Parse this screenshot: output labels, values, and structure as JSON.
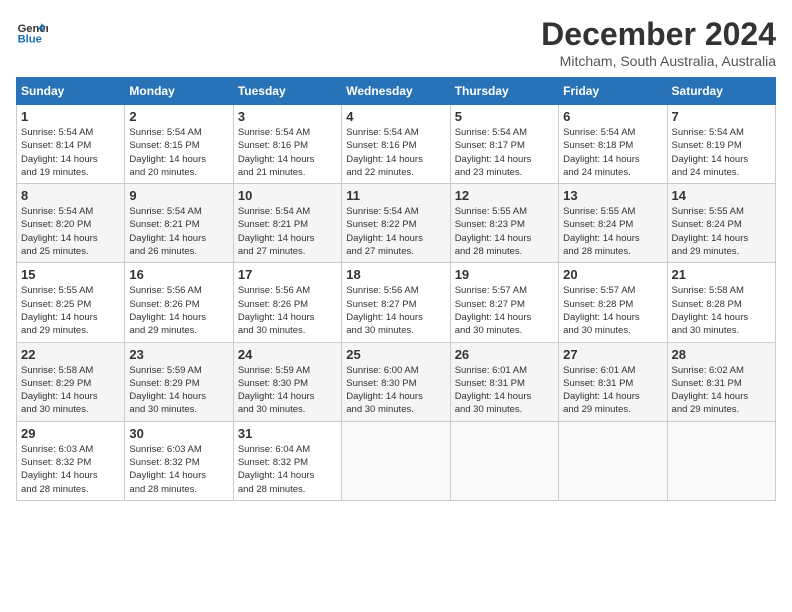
{
  "header": {
    "logo_line1": "General",
    "logo_line2": "Blue",
    "month": "December 2024",
    "location": "Mitcham, South Australia, Australia"
  },
  "days_of_week": [
    "Sunday",
    "Monday",
    "Tuesday",
    "Wednesday",
    "Thursday",
    "Friday",
    "Saturday"
  ],
  "weeks": [
    [
      {
        "day": "1",
        "info": "Sunrise: 5:54 AM\nSunset: 8:14 PM\nDaylight: 14 hours\nand 19 minutes."
      },
      {
        "day": "2",
        "info": "Sunrise: 5:54 AM\nSunset: 8:15 PM\nDaylight: 14 hours\nand 20 minutes."
      },
      {
        "day": "3",
        "info": "Sunrise: 5:54 AM\nSunset: 8:16 PM\nDaylight: 14 hours\nand 21 minutes."
      },
      {
        "day": "4",
        "info": "Sunrise: 5:54 AM\nSunset: 8:16 PM\nDaylight: 14 hours\nand 22 minutes."
      },
      {
        "day": "5",
        "info": "Sunrise: 5:54 AM\nSunset: 8:17 PM\nDaylight: 14 hours\nand 23 minutes."
      },
      {
        "day": "6",
        "info": "Sunrise: 5:54 AM\nSunset: 8:18 PM\nDaylight: 14 hours\nand 24 minutes."
      },
      {
        "day": "7",
        "info": "Sunrise: 5:54 AM\nSunset: 8:19 PM\nDaylight: 14 hours\nand 24 minutes."
      }
    ],
    [
      {
        "day": "8",
        "info": "Sunrise: 5:54 AM\nSunset: 8:20 PM\nDaylight: 14 hours\nand 25 minutes."
      },
      {
        "day": "9",
        "info": "Sunrise: 5:54 AM\nSunset: 8:21 PM\nDaylight: 14 hours\nand 26 minutes."
      },
      {
        "day": "10",
        "info": "Sunrise: 5:54 AM\nSunset: 8:21 PM\nDaylight: 14 hours\nand 27 minutes."
      },
      {
        "day": "11",
        "info": "Sunrise: 5:54 AM\nSunset: 8:22 PM\nDaylight: 14 hours\nand 27 minutes."
      },
      {
        "day": "12",
        "info": "Sunrise: 5:55 AM\nSunset: 8:23 PM\nDaylight: 14 hours\nand 28 minutes."
      },
      {
        "day": "13",
        "info": "Sunrise: 5:55 AM\nSunset: 8:24 PM\nDaylight: 14 hours\nand 28 minutes."
      },
      {
        "day": "14",
        "info": "Sunrise: 5:55 AM\nSunset: 8:24 PM\nDaylight: 14 hours\nand 29 minutes."
      }
    ],
    [
      {
        "day": "15",
        "info": "Sunrise: 5:55 AM\nSunset: 8:25 PM\nDaylight: 14 hours\nand 29 minutes."
      },
      {
        "day": "16",
        "info": "Sunrise: 5:56 AM\nSunset: 8:26 PM\nDaylight: 14 hours\nand 29 minutes."
      },
      {
        "day": "17",
        "info": "Sunrise: 5:56 AM\nSunset: 8:26 PM\nDaylight: 14 hours\nand 30 minutes."
      },
      {
        "day": "18",
        "info": "Sunrise: 5:56 AM\nSunset: 8:27 PM\nDaylight: 14 hours\nand 30 minutes."
      },
      {
        "day": "19",
        "info": "Sunrise: 5:57 AM\nSunset: 8:27 PM\nDaylight: 14 hours\nand 30 minutes."
      },
      {
        "day": "20",
        "info": "Sunrise: 5:57 AM\nSunset: 8:28 PM\nDaylight: 14 hours\nand 30 minutes."
      },
      {
        "day": "21",
        "info": "Sunrise: 5:58 AM\nSunset: 8:28 PM\nDaylight: 14 hours\nand 30 minutes."
      }
    ],
    [
      {
        "day": "22",
        "info": "Sunrise: 5:58 AM\nSunset: 8:29 PM\nDaylight: 14 hours\nand 30 minutes."
      },
      {
        "day": "23",
        "info": "Sunrise: 5:59 AM\nSunset: 8:29 PM\nDaylight: 14 hours\nand 30 minutes."
      },
      {
        "day": "24",
        "info": "Sunrise: 5:59 AM\nSunset: 8:30 PM\nDaylight: 14 hours\nand 30 minutes."
      },
      {
        "day": "25",
        "info": "Sunrise: 6:00 AM\nSunset: 8:30 PM\nDaylight: 14 hours\nand 30 minutes."
      },
      {
        "day": "26",
        "info": "Sunrise: 6:01 AM\nSunset: 8:31 PM\nDaylight: 14 hours\nand 30 minutes."
      },
      {
        "day": "27",
        "info": "Sunrise: 6:01 AM\nSunset: 8:31 PM\nDaylight: 14 hours\nand 29 minutes."
      },
      {
        "day": "28",
        "info": "Sunrise: 6:02 AM\nSunset: 8:31 PM\nDaylight: 14 hours\nand 29 minutes."
      }
    ],
    [
      {
        "day": "29",
        "info": "Sunrise: 6:03 AM\nSunset: 8:32 PM\nDaylight: 14 hours\nand 28 minutes."
      },
      {
        "day": "30",
        "info": "Sunrise: 6:03 AM\nSunset: 8:32 PM\nDaylight: 14 hours\nand 28 minutes."
      },
      {
        "day": "31",
        "info": "Sunrise: 6:04 AM\nSunset: 8:32 PM\nDaylight: 14 hours\nand 28 minutes."
      },
      {
        "day": "",
        "info": ""
      },
      {
        "day": "",
        "info": ""
      },
      {
        "day": "",
        "info": ""
      },
      {
        "day": "",
        "info": ""
      }
    ]
  ]
}
